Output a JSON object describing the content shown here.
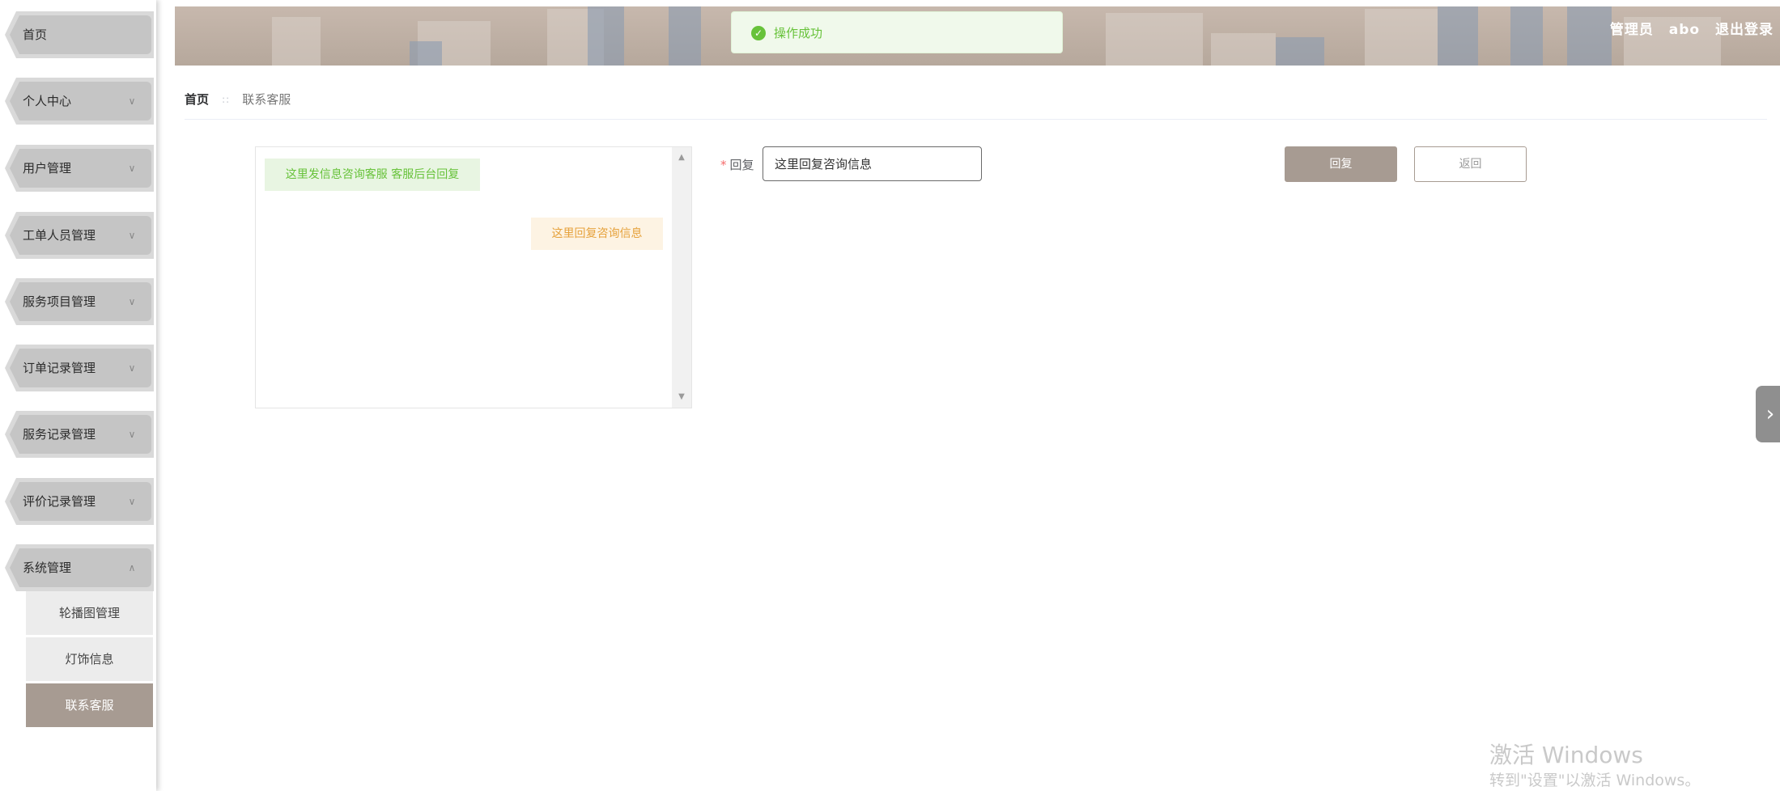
{
  "sidebar": {
    "items": [
      {
        "label": "首页",
        "has_chevron": false
      },
      {
        "label": "个人中心",
        "has_chevron": true
      },
      {
        "label": "用户管理",
        "has_chevron": true
      },
      {
        "label": "工单人员管理",
        "has_chevron": true
      },
      {
        "label": "服务项目管理",
        "has_chevron": true
      },
      {
        "label": "订单记录管理",
        "has_chevron": true
      },
      {
        "label": "服务记录管理",
        "has_chevron": true
      },
      {
        "label": "评价记录管理",
        "has_chevron": true
      },
      {
        "label": "系统管理",
        "has_chevron": true,
        "expanded": true
      }
    ],
    "subitems": [
      {
        "label": "轮播图管理"
      },
      {
        "label": "灯饰信息"
      },
      {
        "label": "联系客服",
        "active": true
      }
    ]
  },
  "header": {
    "role": "管理员",
    "username": "abo",
    "logout": "退出登录"
  },
  "toast": {
    "icon": "check-circle-icon",
    "message": "操作成功"
  },
  "breadcrumb": {
    "home": "首页",
    "current": "联系客服"
  },
  "chat": {
    "messages": [
      {
        "side": "left",
        "text": "这里发信息咨询客服 客服后台回复"
      },
      {
        "side": "right",
        "text": "这里回复咨询信息"
      }
    ]
  },
  "form": {
    "reply_label": "回复",
    "reply_value": "这里回复咨询信息",
    "submit_label": "回复",
    "back_label": "返回"
  },
  "watermark": {
    "title": "激活 Windows",
    "subtitle": "转到\"设置\"以激活 Windows。"
  },
  "colors": {
    "accent": "#a79b92",
    "success": "#67c23a",
    "warning": "#e6a23c"
  }
}
